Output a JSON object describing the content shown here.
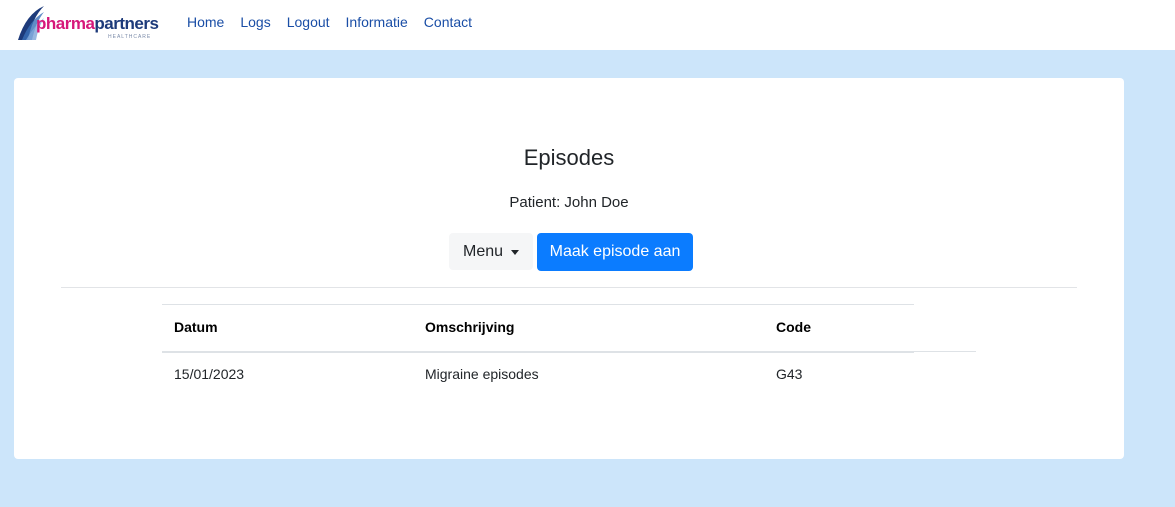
{
  "nav": {
    "logo": {
      "brand_pharma": "pharma",
      "brand_partners": "partners",
      "brand_sub": "HEALTHCARE",
      "colors": {
        "pharma": "#d6187a",
        "partners": "#1d3a7a"
      }
    },
    "links": [
      "Home",
      "Logs",
      "Logout",
      "Informatie",
      "Contact"
    ]
  },
  "main": {
    "title": "Episodes",
    "patient_line": "Patient: John Doe",
    "menu_button": "Menu",
    "create_button": "Maak episode aan",
    "table": {
      "headers": [
        "Datum",
        "Omschrijving",
        "Code"
      ],
      "rows": [
        [
          "15/01/2023",
          "Migraine episodes",
          "G43"
        ]
      ]
    }
  },
  "colors": {
    "page_background": "#cce5fa",
    "primary": "#0b7cff",
    "nav_link": "#1a4ea6"
  }
}
